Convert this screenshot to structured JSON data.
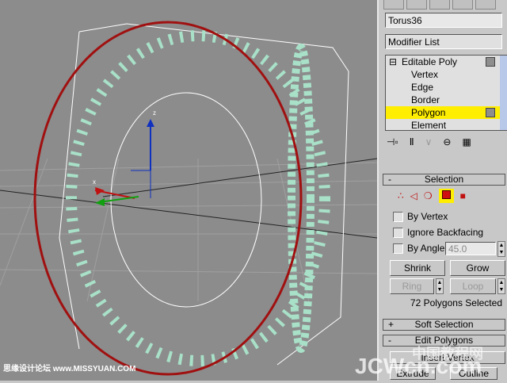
{
  "viewport": {
    "axis_label": "z",
    "x_label": "x"
  },
  "panel": {
    "object_name": "Torus36",
    "modifier_list": "Modifier List",
    "stack": [
      {
        "label": "Editable Poly",
        "top": true
      },
      {
        "label": "Vertex"
      },
      {
        "label": "Edge"
      },
      {
        "label": "Border"
      },
      {
        "label": "Polygon",
        "selected": true
      },
      {
        "label": "Element"
      }
    ],
    "selection": {
      "title": "Selection",
      "collapse": "-",
      "by_vertex": "By Vertex",
      "ignore_backfacing": "Ignore Backfacing",
      "by_angle": "By Angle:",
      "angle_value": "45.0",
      "shrink": "Shrink",
      "grow": "Grow",
      "ring": "Ring",
      "loop": "Loop",
      "status": "72 Polygons Selected"
    },
    "soft_selection": {
      "title": "Soft Selection",
      "expand": "+"
    },
    "edit_polygons": {
      "title": "Edit Polygons",
      "collapse": "-",
      "insert_vertex": "Insert Vertex",
      "extrude": "Extrude",
      "outline": "Outline"
    }
  },
  "watermarks": {
    "left": "思缘设计论坛 www.MISSYUAN.COM",
    "right_cn": "中国教程网",
    "right": "JCWcn.com"
  },
  "colors": {
    "selected": "#ffee00",
    "selection_red": "#a01010",
    "viewport": "#8c8c8c"
  }
}
